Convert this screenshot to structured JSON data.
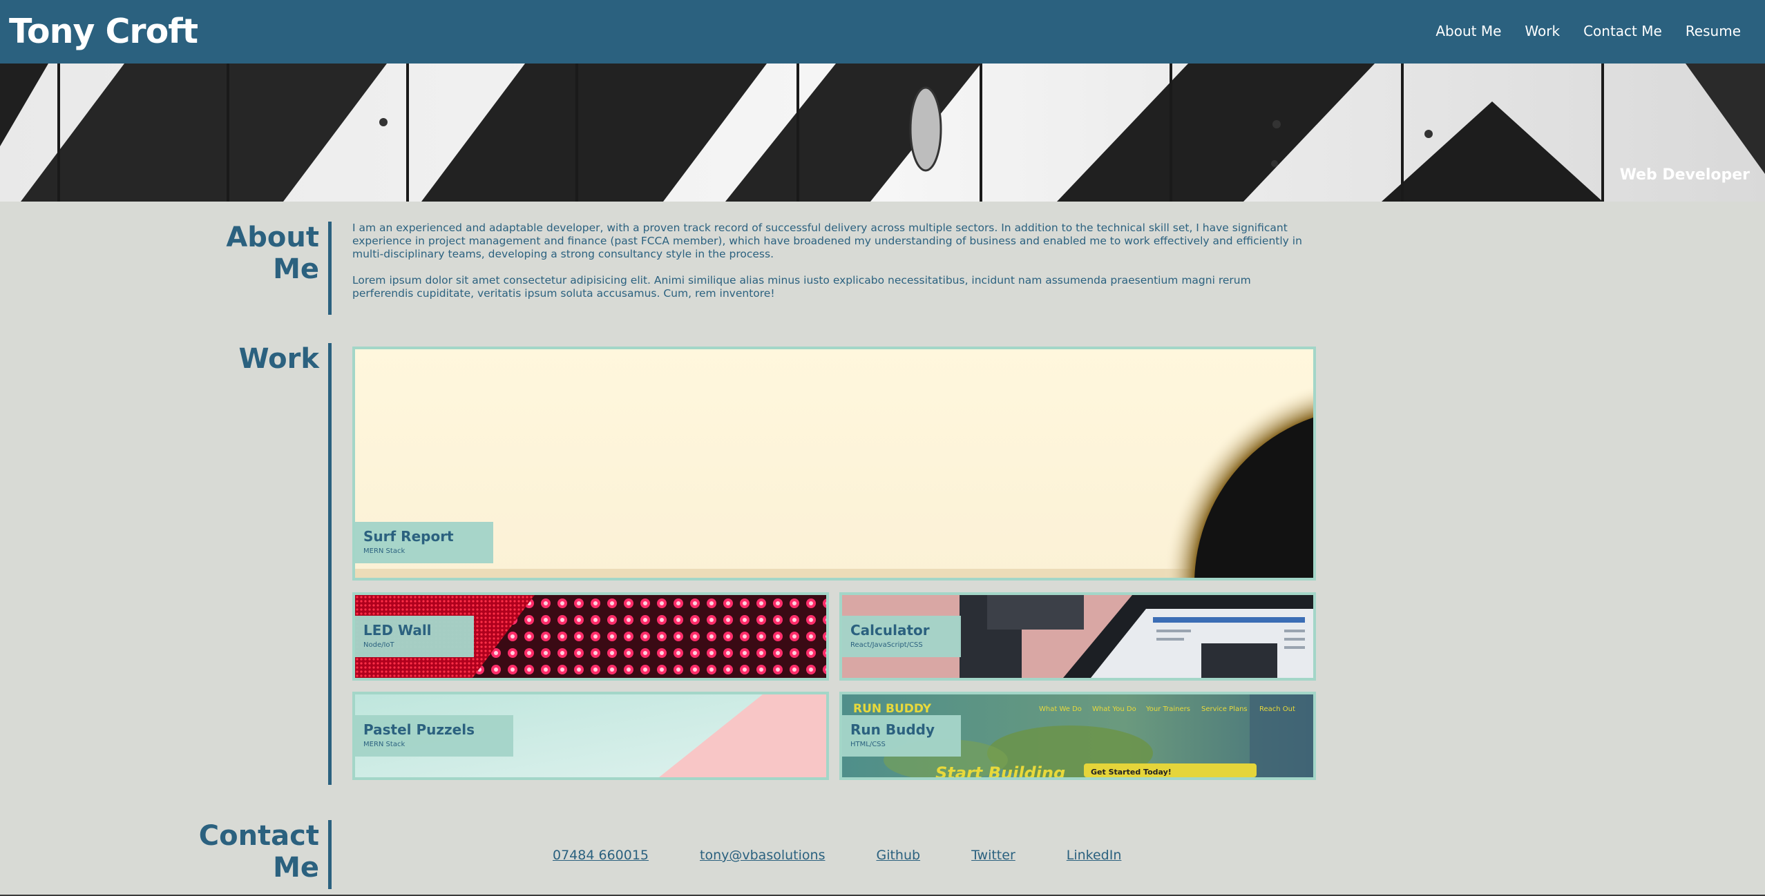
{
  "header": {
    "title": "Tony Croft",
    "nav": [
      "About Me",
      "Work",
      "Contact Me",
      "Resume"
    ]
  },
  "hero": {
    "caption": "Web Developer"
  },
  "about": {
    "title_line1": "About",
    "title_line2": "Me",
    "paragraphs": [
      "I am an experienced and adaptable developer, with a proven track record of successful delivery across multiple sectors. In addition to the technical skill set, I have significant experience in project management and finance (past FCCA member), which have broadened my understanding of business and enabled me to work effectively and efficiently in multi-disciplinary teams, developing a strong consultancy style in the process.",
      "Lorem ipsum dolor sit amet consectetur adipisicing elit. Animi similique alias minus iusto explicabo necessitatibus, incidunt nam assumenda praesentium magni rerum perferendis cupiditate, veritatis ipsum soluta accusamus. Cum, rem inventore!"
    ]
  },
  "work": {
    "title": "Work",
    "projects": [
      {
        "name": "Surf Report",
        "tech": "MERN Stack"
      },
      {
        "name": "LED Wall",
        "tech": "Node/IoT"
      },
      {
        "name": "Calculator",
        "tech": "React/JavaScript/CSS"
      },
      {
        "name": "Pastel Puzzels",
        "tech": "MERN Stack"
      },
      {
        "name": "Run Buddy",
        "tech": "HTML/CSS"
      }
    ],
    "run_buddy_preview": {
      "brand": "RUN BUDDY",
      "menu": [
        "What We Do",
        "What You Do",
        "Your Trainers",
        "Service Plans",
        "Reach Out"
      ],
      "headline": "Start Building",
      "cta": "Get Started Today!"
    }
  },
  "contact": {
    "title_line1": "Contact",
    "title_line2": "Me",
    "links": [
      "07484 660015",
      "tony@vbasolutions",
      "Github",
      "Twitter",
      "LinkedIn"
    ]
  },
  "colors": {
    "primary": "#2b617f",
    "accent": "#a3d6c8",
    "background": "#d8dad5"
  }
}
